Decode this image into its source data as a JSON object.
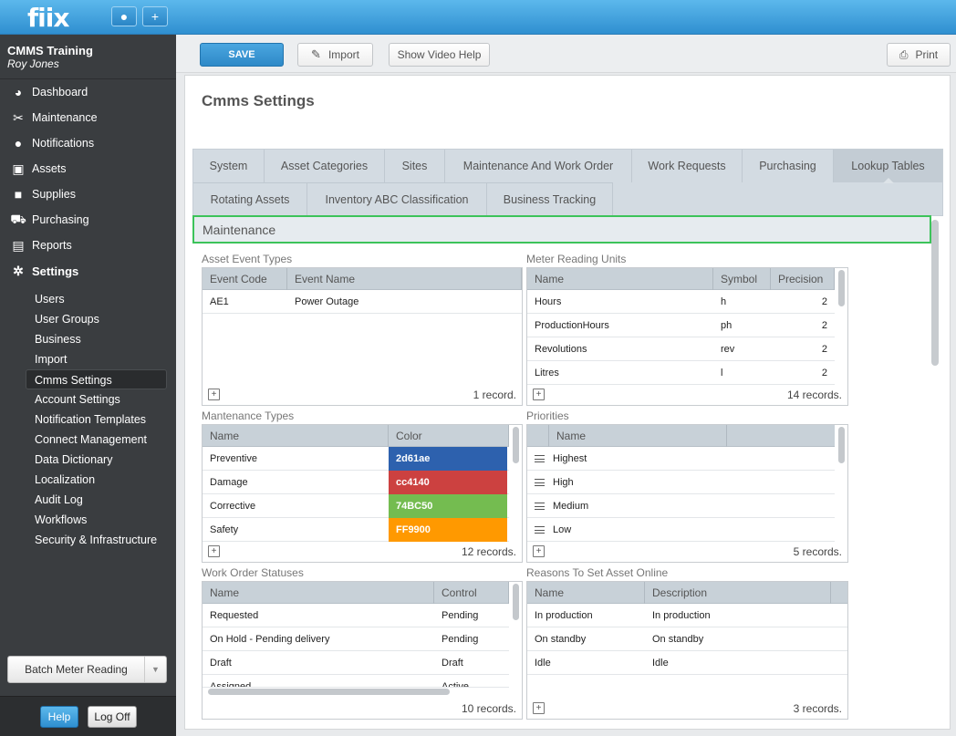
{
  "app": {
    "logo": "fiix"
  },
  "topbar": {
    "user_icon": "user-icon",
    "add_icon": "plus-icon",
    "add_label": "+"
  },
  "sidebar": {
    "org": "CMMS Training",
    "user": "Roy Jones",
    "nav": [
      {
        "label": "Dashboard",
        "icon": "palette-icon",
        "glyph": "◕"
      },
      {
        "label": "Maintenance",
        "icon": "tools-icon",
        "glyph": "✂"
      },
      {
        "label": "Notifications",
        "icon": "speech-bubble-icon",
        "glyph": "●"
      },
      {
        "label": "Assets",
        "icon": "box-icon",
        "glyph": "▣"
      },
      {
        "label": "Supplies",
        "icon": "truck-icon",
        "glyph": "■"
      },
      {
        "label": "Purchasing",
        "icon": "cart-icon",
        "glyph": "⛟"
      },
      {
        "label": "Reports",
        "icon": "chart-icon",
        "glyph": "▤"
      },
      {
        "label": "Settings",
        "icon": "gear-icon",
        "glyph": "✲"
      }
    ],
    "settings_items": [
      "Users",
      "User Groups",
      "Business",
      "Import",
      "Cmms Settings",
      "Account Settings",
      "Notification Templates",
      "Connect Management",
      "Data Dictionary",
      "Localization",
      "Audit Log",
      "Workflows",
      "Security & Infrastructure"
    ],
    "active_settings_item": "Cmms Settings",
    "batch_label": "Batch Meter Reading",
    "help_label": "Help",
    "logoff_label": "Log Off"
  },
  "toolbar": {
    "save_label": "SAVE",
    "import_label": "Import",
    "video_help_label": "Show Video Help",
    "print_label": "Print"
  },
  "page": {
    "title": "Cmms Settings",
    "tabs_row1": [
      "System",
      "Asset Categories",
      "Sites",
      "Maintenance And Work Order",
      "Work Requests",
      "Purchasing",
      "Lookup Tables"
    ],
    "tabs_row2": [
      "Rotating Assets",
      "Inventory ABC Classification",
      "Business Tracking"
    ],
    "active_tab": "Lookup Tables",
    "section": "Maintenance"
  },
  "asset_event_types": {
    "title": "Asset Event Types",
    "columns": [
      "Event Code",
      "Event Name"
    ],
    "rows": [
      [
        "AE1",
        "Power Outage"
      ]
    ],
    "count": "1 record."
  },
  "meter_reading_units": {
    "title": "Meter Reading Units",
    "columns": [
      "Name",
      "Symbol",
      "Precision"
    ],
    "rows": [
      [
        "Hours",
        "h",
        "2"
      ],
      [
        "ProductionHours",
        "ph",
        "2"
      ],
      [
        "Revolutions",
        "rev",
        "2"
      ],
      [
        "Litres",
        "l",
        "2"
      ]
    ],
    "count": "14 records."
  },
  "maintenance_types": {
    "title": "Mantenance Types",
    "columns": [
      "Name",
      "Color"
    ],
    "rows": [
      {
        "name": "Preventive",
        "color": "2d61ae",
        "hex": "#2d61ae"
      },
      {
        "name": "Damage",
        "color": "cc4140",
        "hex": "#cc4140"
      },
      {
        "name": "Corrective",
        "color": "74BC50",
        "hex": "#74bc50"
      },
      {
        "name": "Safety",
        "color": "FF9900",
        "hex": "#ff9900"
      }
    ],
    "count": "12 records."
  },
  "priorities": {
    "title": "Priorities",
    "columns": [
      "Name"
    ],
    "rows": [
      "Highest",
      "High",
      "Medium",
      "Low"
    ],
    "count": "5 records."
  },
  "work_order_statuses": {
    "title": "Work Order Statuses",
    "columns": [
      "Name",
      "Control"
    ],
    "rows": [
      [
        "Requested",
        "Pending"
      ],
      [
        "On Hold - Pending delivery",
        "Pending"
      ],
      [
        "Draft",
        "Draft"
      ],
      [
        "Assigned",
        "Active"
      ]
    ],
    "count": "10 records."
  },
  "reasons_online": {
    "title": "Reasons To Set Asset Online",
    "columns": [
      "Name",
      "Description"
    ],
    "rows": [
      [
        "In production",
        "In production"
      ],
      [
        "On standby",
        "On standby"
      ],
      [
        "Idle",
        "Idle"
      ]
    ],
    "count": "3 records."
  }
}
